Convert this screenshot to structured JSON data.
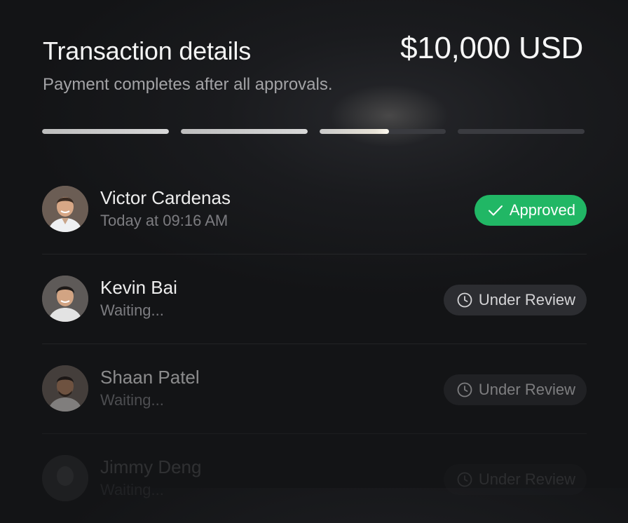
{
  "header": {
    "title": "Transaction details",
    "amount": "$10,000 USD",
    "subtitle": "Payment completes after all approvals."
  },
  "progress": {
    "steps": [
      1,
      1,
      0.55,
      0
    ]
  },
  "approvers": [
    {
      "name": "Victor Cardenas",
      "status": "Today at 09:16 AM",
      "badge": "Approved",
      "badge_icon": "check-icon"
    },
    {
      "name": "Kevin Bai",
      "status": "Waiting...",
      "badge": "Under Review",
      "badge_icon": "clock-icon"
    },
    {
      "name": "Shaan Patel",
      "status": "Waiting...",
      "badge": "Under Review",
      "badge_icon": "clock-icon"
    },
    {
      "name": "Jimmy Deng",
      "status": "Waiting...",
      "badge": "Under Review",
      "badge_icon": "clock-icon"
    }
  ],
  "colors": {
    "approved": "#21b765",
    "review_bg": "#2c2d31",
    "background": "#1a1b1e"
  }
}
